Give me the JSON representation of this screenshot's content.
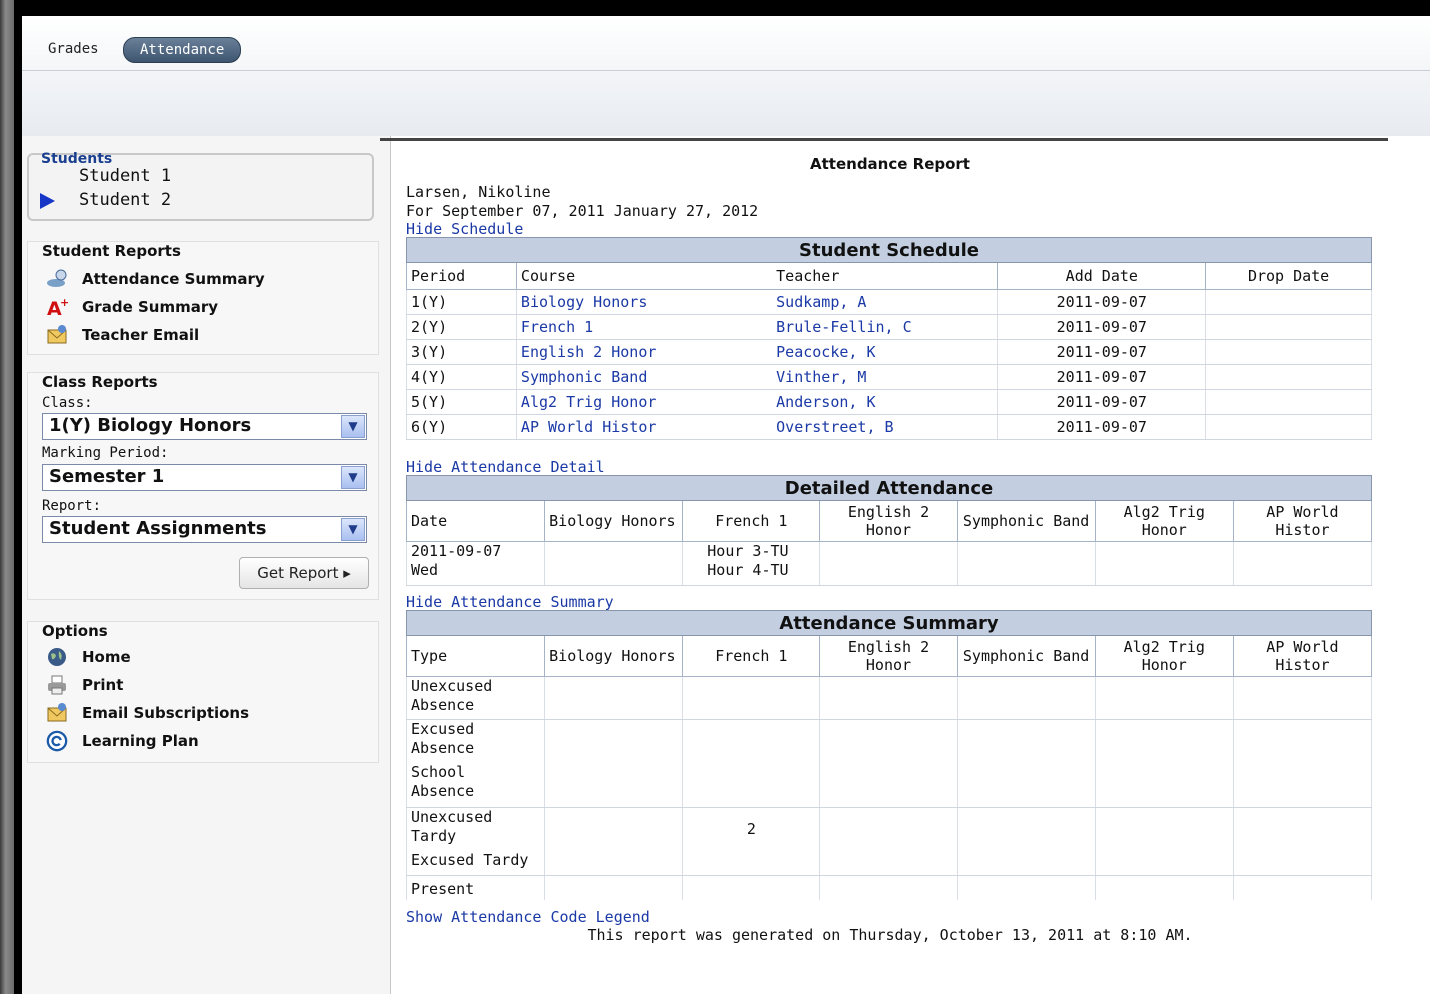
{
  "tabs": {
    "grades": "Grades",
    "attendance": "Attendance"
  },
  "sidebar": {
    "students_title": "Students",
    "students": [
      "Student 1",
      "Student 2"
    ],
    "student_reports": {
      "title": "Student Reports",
      "items": [
        {
          "label": "Attendance Summary",
          "icon": "attendance-icon"
        },
        {
          "label": "Grade Summary",
          "icon": "grade-icon"
        },
        {
          "label": "Teacher Email",
          "icon": "email-icon"
        }
      ]
    },
    "class_reports": {
      "title": "Class Reports",
      "class_label": "Class:",
      "class_value": "1(Y) Biology Honors",
      "marking_label": "Marking Period:",
      "marking_value": "Semester 1",
      "report_label": "Report:",
      "report_value": "Student Assignments",
      "get_report": "Get Report ▸"
    },
    "options": {
      "title": "Options",
      "items": [
        {
          "label": "Home",
          "icon": "globe-icon"
        },
        {
          "label": "Print",
          "icon": "printer-icon"
        },
        {
          "label": "Email Subscriptions",
          "icon": "email-icon"
        },
        {
          "label": "Learning Plan",
          "icon": "learning-plan-icon"
        }
      ]
    }
  },
  "report": {
    "title": "Attendance Report",
    "student_name": "Larsen, Nikoline",
    "date_range": "For September 07, 2011 January 27, 2012",
    "hide_schedule": "Hide Schedule",
    "schedule": {
      "caption": "Student Schedule",
      "headers": [
        "Period",
        "Course",
        "Teacher",
        "Add Date",
        "Drop Date"
      ],
      "rows": [
        [
          "1(Y)",
          "Biology Honors",
          "Sudkamp, A",
          "2011-09-07",
          ""
        ],
        [
          "2(Y)",
          "French 1",
          "Brule-Fellin, C",
          "2011-09-07",
          ""
        ],
        [
          "3(Y)",
          "English 2 Honor",
          "Peacocke, K",
          "2011-09-07",
          ""
        ],
        [
          "4(Y)",
          "Symphonic Band",
          "Vinther, M",
          "2011-09-07",
          ""
        ],
        [
          "5(Y)",
          "Alg2 Trig Honor",
          "Anderson, K",
          "2011-09-07",
          ""
        ],
        [
          "6(Y)",
          "AP World Histor",
          "Overstreet, B",
          "2011-09-07",
          ""
        ]
      ]
    },
    "hide_detail": "Hide Attendance Detail",
    "detail": {
      "caption": "Detailed Attendance",
      "headers": [
        "Date",
        "Biology Honors",
        "French 1",
        "English 2 Honor",
        "Symphonic Band",
        "Alg2 Trig Honor",
        "AP World Histor"
      ],
      "date_line1": "2011-09-07",
      "date_line2": "Wed",
      "french_line1": "Hour 3-TU",
      "french_line2": "Hour 4-TU"
    },
    "hide_summary": "Hide Attendance Summary",
    "summary": {
      "caption": "Attendance Summary",
      "headers": [
        "Type",
        "Biology Honors",
        "French 1",
        "English 2 Honor",
        "Symphonic Band",
        "Alg2 Trig Honor",
        "AP World Histor"
      ],
      "types": [
        "Unexcused Absence",
        "Excused Absence",
        "School Absence",
        "Unexcused Tardy",
        "Excused Tardy",
        "Present"
      ],
      "unexcused_tardy_french": "2"
    },
    "show_legend": "Show Attendance Code Legend",
    "generated": "This report was generated on Thursday, October 13, 2011 at 8:10 AM."
  }
}
